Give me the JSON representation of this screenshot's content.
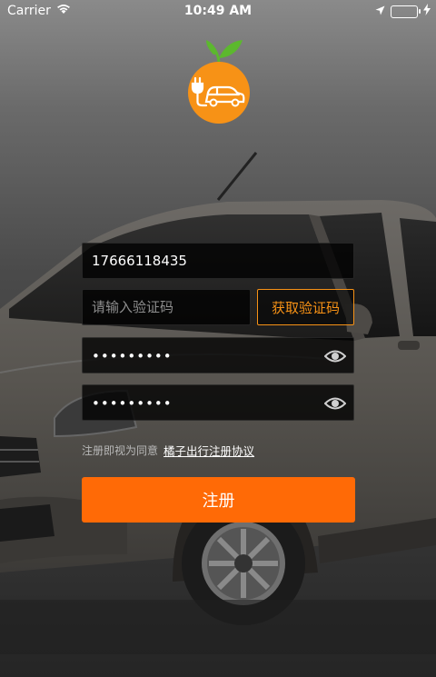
{
  "status_bar": {
    "carrier": "Carrier",
    "time": "10:49 AM",
    "wifi_icon": "wifi-icon",
    "location_icon": "location-arrow-icon",
    "charging_icon": "bolt-icon",
    "battery_color": "#4cd964"
  },
  "logo": {
    "icon": "orange-electric-car-logo",
    "color": "#f79216",
    "leaf_color": "#5cb82e"
  },
  "form": {
    "phone_value": "17666118435",
    "code_placeholder": "请输入验证码",
    "get_code_label": "获取验证码",
    "password_mask": "•••••••••",
    "confirm_mask": "•••••••••",
    "eye_icon": "eye-icon"
  },
  "agreement": {
    "prefix": "注册即视为同意",
    "link": "橘子出行注册协议"
  },
  "register_button": {
    "label": "注册",
    "color": "#ff6a06"
  },
  "accent_color": "#f79216"
}
